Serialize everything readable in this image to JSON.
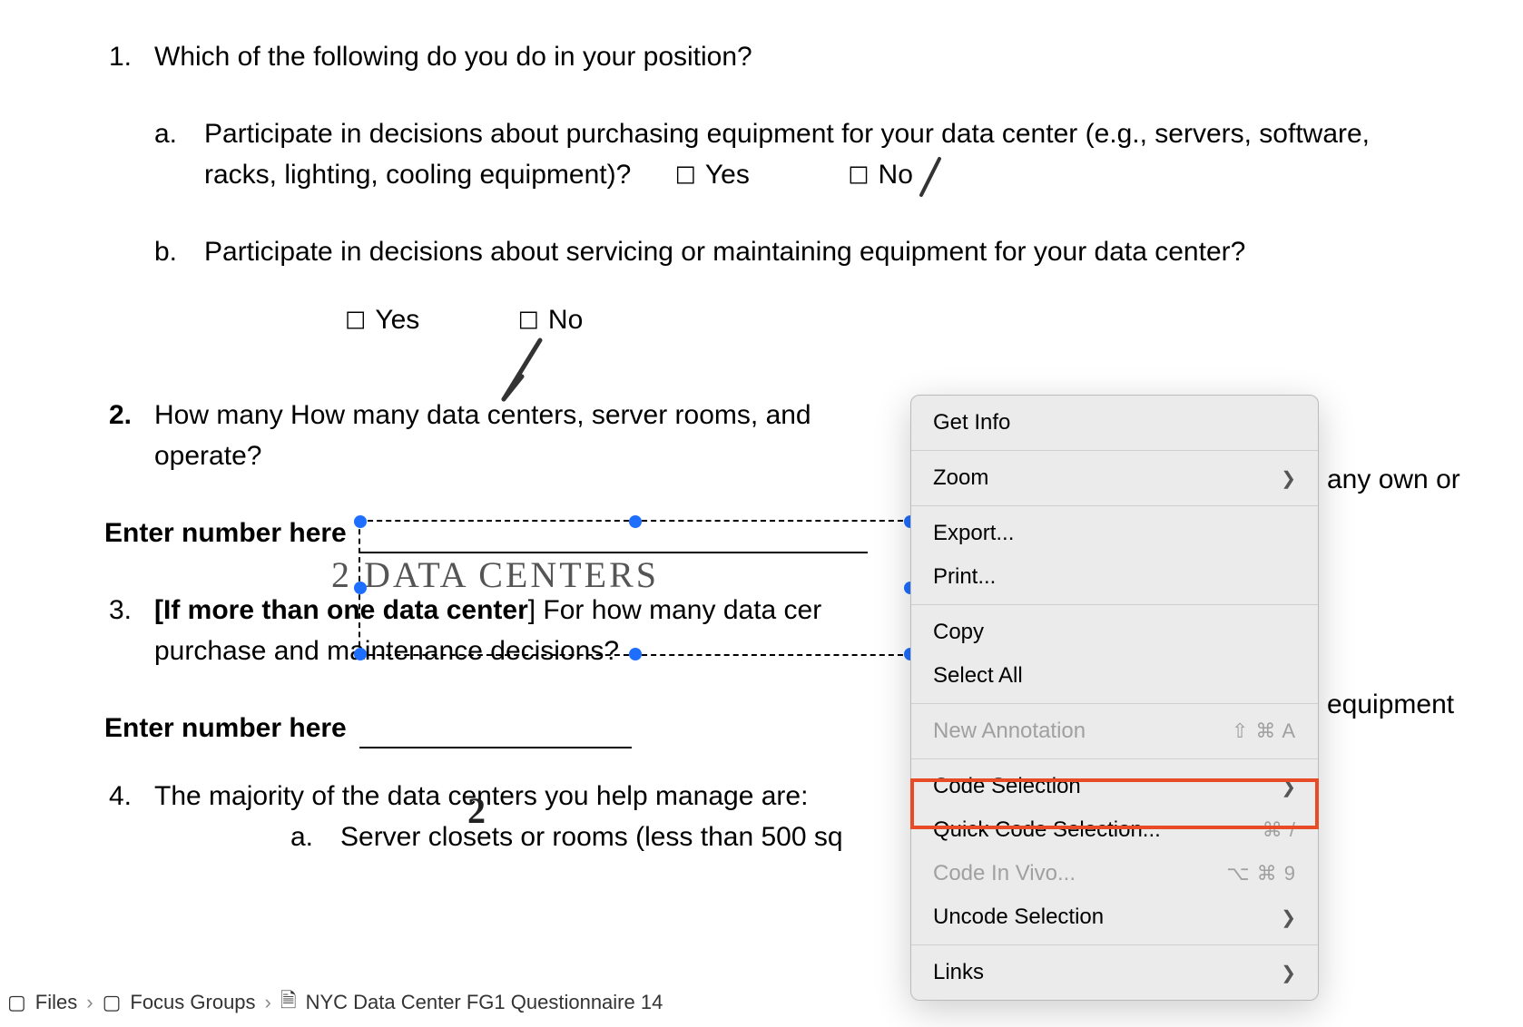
{
  "q1": {
    "num": "1.",
    "text": "Which of the following do you do in your position?",
    "a": {
      "letter": "a.",
      "text": "Participate in decisions about purchasing equipment for your data center (e.g., servers, software, racks, lighting, cooling equipment)?",
      "yes": "Yes",
      "no": "No"
    },
    "b": {
      "letter": "b.",
      "text": "Participate in decisions about servicing or maintaining equipment for your data center?",
      "yes": "Yes",
      "no": "No"
    }
  },
  "q2": {
    "num": "2.",
    "text_visible": "How many How many data centers, server rooms, and",
    "operate": "operate?",
    "overflow": "any own or",
    "enter_label": "Enter number here",
    "handwritten": "2 DATA CENTERS"
  },
  "q3": {
    "num": "3.",
    "prefix_bold": "[If more than one data center",
    "rest_visible": "] For how many data cer",
    "overflow": "equipment",
    "line2": "purchase and maintenance decisions?",
    "enter_label": "Enter number here",
    "handwritten": "2"
  },
  "q4": {
    "num": "4.",
    "text": "The majority of the data centers you help manage are:",
    "a": {
      "letter": "a.",
      "text": "Server closets or rooms (less than 500 sq"
    }
  },
  "checkbox_glyph": "☐",
  "menu": {
    "get_info": "Get Info",
    "zoom": "Zoom",
    "export": "Export...",
    "print": "Print...",
    "copy": "Copy",
    "select_all": "Select All",
    "new_annotation": "New Annotation",
    "new_annotation_shortcut": "⇧ ⌘ A",
    "code_selection": "Code Selection",
    "quick_code": "Quick Code Selection...",
    "quick_code_shortcut": "⌘ /",
    "code_in_vivo": "Code In Vivo...",
    "code_in_vivo_shortcut": "⌥ ⌘ 9",
    "uncode": "Uncode Selection",
    "links": "Links"
  },
  "breadcrumb": {
    "files": "Files",
    "focus_groups": "Focus Groups",
    "doc": "NYC Data Center FG1 Questionnaire 14"
  }
}
